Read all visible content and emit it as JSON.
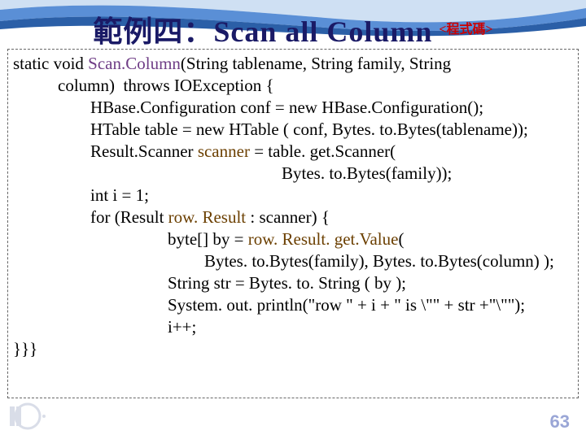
{
  "slide": {
    "title_cjk": "範例四：",
    "title_en": "Scan all Column",
    "tag": "<程式碼>",
    "page_number": "63"
  },
  "code": {
    "l01a": "static void ",
    "l01b": "Scan.Column",
    "l01c": "(String tablename, String family, String",
    "l02": "column)  throws IOException {",
    "l03": "HBase.Configuration conf = new HBase.Configuration();",
    "l04": "HTable table = new HTable ( conf, Bytes. to.Bytes(tablename));",
    "l05a": "Result.Scanner ",
    "l05b": "scanner",
    "l05c": " = table. get.Scanner(",
    "l06": "Bytes. to.Bytes(family));",
    "l07": "int i = 1;",
    "l08a": "for (Result ",
    "l08b": "row. Result",
    "l08c": " : scanner) {",
    "l09a": "byte[] by = ",
    "l09b": "row. Result. get.Value",
    "l09c": "(",
    "l10": "Bytes. to.Bytes(family), Bytes. to.Bytes(column) );",
    "l11": "String str = Bytes. to. String ( by );",
    "l12": "System. out. println(\"row \" + i + \" is \\\"\" + str +\"\\\"\");",
    "l13": "i++;",
    "l14": "}}}"
  }
}
